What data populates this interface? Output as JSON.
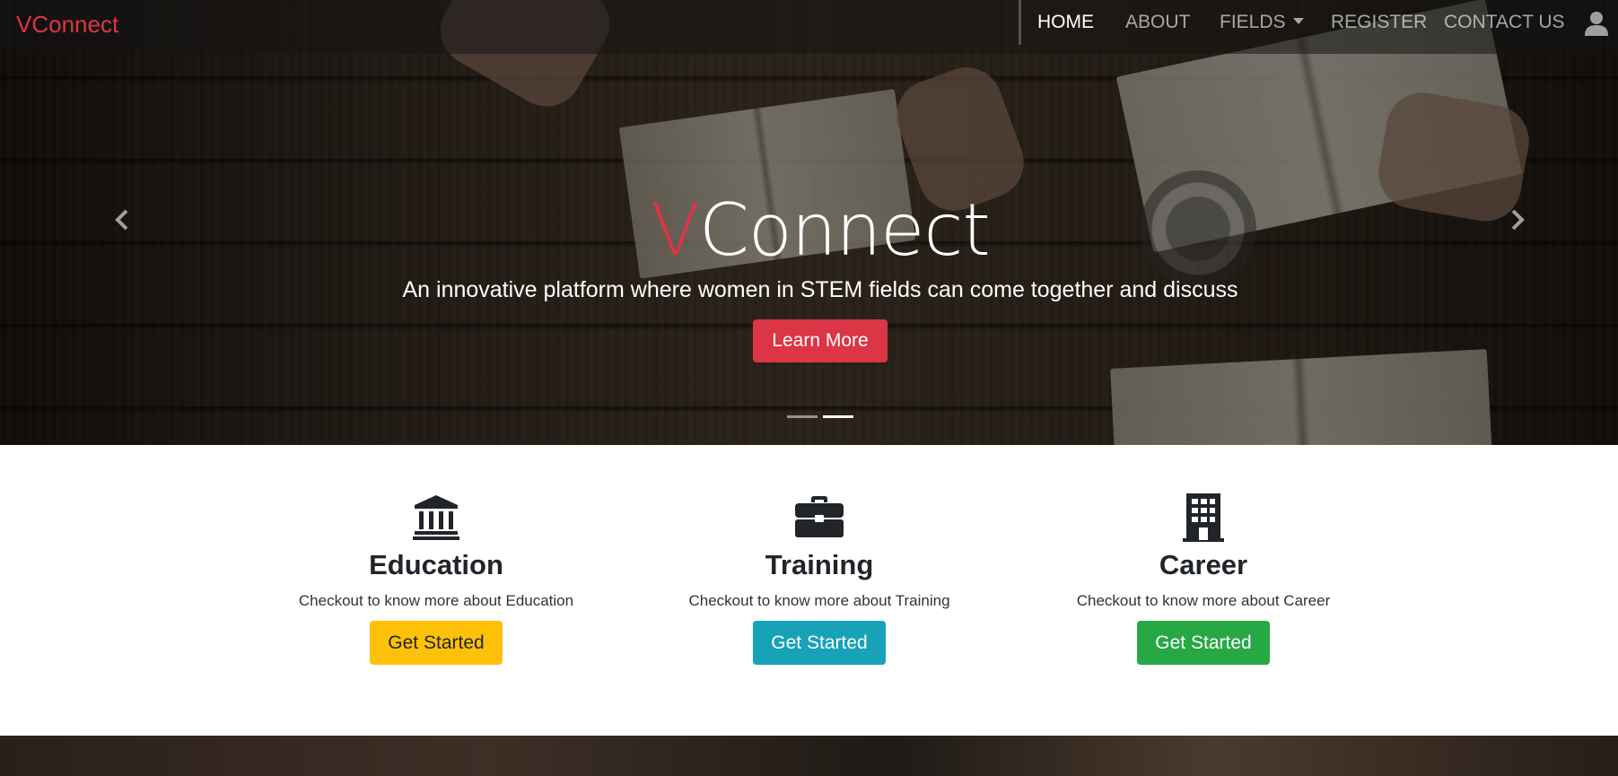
{
  "brand": "VConnect",
  "nav": {
    "items": [
      {
        "label": "HOME",
        "active": true
      },
      {
        "label": "ABOUT",
        "active": false
      },
      {
        "label": "FIELDS",
        "active": false,
        "dropdown": true
      },
      {
        "label": "REGISTER",
        "active": false
      },
      {
        "label": "CONTACT US",
        "active": false
      }
    ],
    "user_icon": "user-icon"
  },
  "hero": {
    "title_accent": "V",
    "title_rest": "Connect",
    "subtitle": "An innovative platform where women in STEM fields can come together and discuss",
    "cta_label": "Learn More",
    "slides": 2,
    "active_slide": 2
  },
  "features": [
    {
      "icon": "university-icon",
      "title": "Education",
      "text": "Checkout to know more about Education",
      "button": "Get Started",
      "color": "#ffc107"
    },
    {
      "icon": "briefcase-icon",
      "title": "Training",
      "text": "Checkout to know more about Training",
      "button": "Get Started",
      "color": "#17a2b8"
    },
    {
      "icon": "building-icon",
      "title": "Career",
      "text": "Checkout to know more about Career",
      "button": "Get Started",
      "color": "#28a745"
    }
  ],
  "colors": {
    "accent": "#dc3545",
    "dark": "#212529"
  }
}
